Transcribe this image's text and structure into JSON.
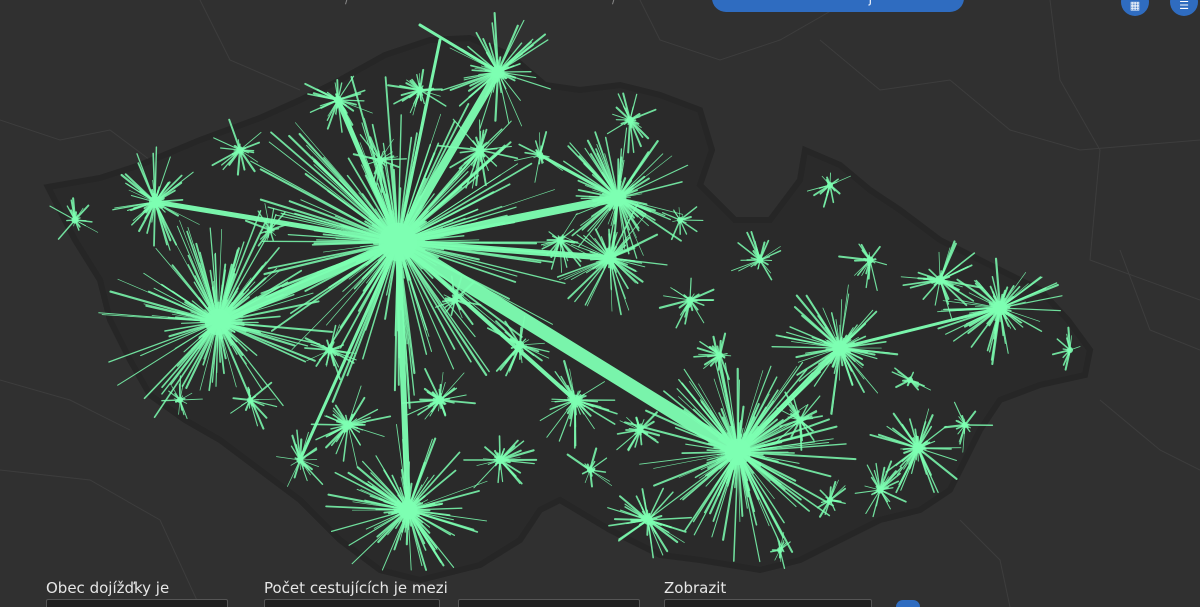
{
  "map": {
    "line_color": "#7dffb2",
    "background_color": "#303030",
    "country_fill": "#2a2a2a",
    "border_color": "#262626",
    "admin_line_color": "#3d3d3d",
    "hub_count_note_icon": "origin-destination-flows"
  },
  "top_bar": {
    "pill_text": "j",
    "left_text_a": "/",
    "left_text_b": "/",
    "button_1_icon": "grid-icon",
    "button_2_icon": "menu-icon",
    "accent_color": "#2f6cc0"
  },
  "filters": {
    "commute_town_label": "Obec dojížďky je",
    "passenger_count_label": "Počet cestujících je mezi",
    "display_label": "Zobrazit"
  }
}
